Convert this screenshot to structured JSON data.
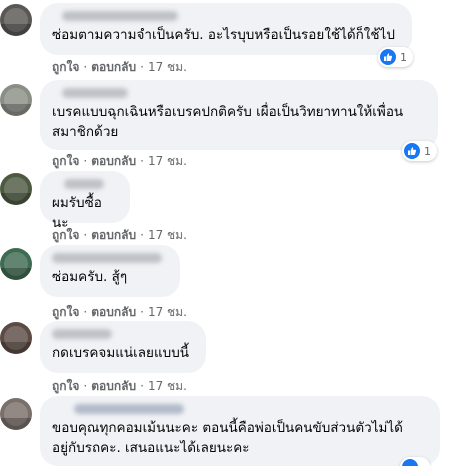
{
  "comments": [
    {
      "text": "ซ่อมตามความจำเป็นครับ. อะไรบุบหรือเป็นรอยใช้ได้ก็ใช้ไป",
      "actions": {
        "like": "ถูกใจ",
        "reply": "ตอบกลับ",
        "time": "17 ชม."
      },
      "reaction_count": "1"
    },
    {
      "text": "เบรคแบบฉุกเฉินหรือเบรคปกติครับ เผื่อเป็นวิทยาทานให้เพื่อน\nสมาชิกด้วย",
      "actions": {
        "like": "ถูกใจ",
        "reply": "ตอบกลับ",
        "time": "17 ชม."
      },
      "reaction_count": "1"
    },
    {
      "text": "ผมรับซื้อนะ",
      "actions": {
        "like": "ถูกใจ",
        "reply": "ตอบกลับ",
        "time": "17 ชม."
      }
    },
    {
      "text": "ซ่อมครับ. สู้ๆ",
      "actions": {
        "like": "ถูกใจ",
        "reply": "ตอบกลับ",
        "time": "17 ชม."
      }
    },
    {
      "text": "กดเบรคจมแน่เลยแบบนี้",
      "actions": {
        "like": "ถูกใจ",
        "reply": "ตอบกลับ",
        "time": "17 ชม."
      }
    },
    {
      "text": "ขอบคุณทุกคอมเม้นนะคะ ตอนนี้คือพ่อเป็นคนขับส่วนตัวไม่ได้\nอยู่กับรถคะ. เสนอแนะได้เลยนะคะ"
    }
  ],
  "colors": {
    "bubble": "#f0f2f5",
    "meta": "#65676b",
    "like": "#1877f2"
  },
  "icons": {
    "reaction": "thumbs-up-icon"
  }
}
